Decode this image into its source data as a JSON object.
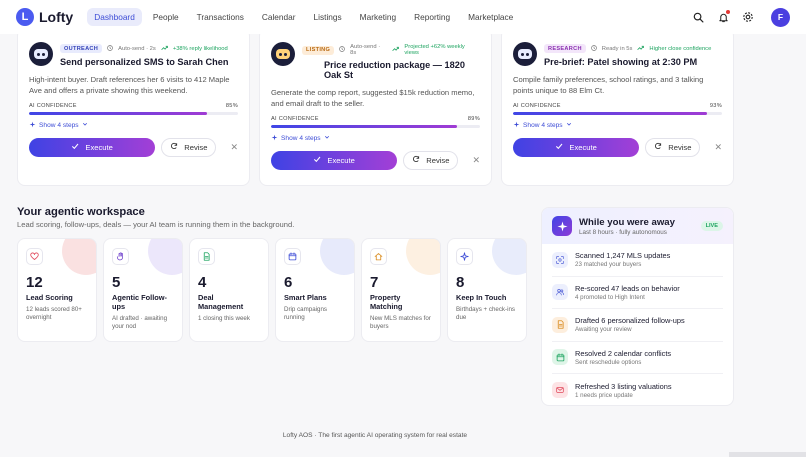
{
  "app": {
    "logo_text": "Lofty",
    "logo_letter": "L"
  },
  "nav": {
    "items": [
      "Dashboard",
      "People",
      "Transactions",
      "Calendar",
      "Listings",
      "Marketing",
      "Reporting",
      "Marketplace"
    ],
    "active": "Dashboard",
    "avatar_letter": "F"
  },
  "cards": [
    {
      "badge": "OUTREACH",
      "send": "Auto-send · 2s",
      "extra": "+38% reply likelihood",
      "title": "Send personalized SMS to Sarah Chen",
      "desc": "High-intent buyer. Draft references her 6 visits to 412 Maple Ave and offers a private showing this weekend.",
      "conf_label": "AI CONFIDENCE",
      "conf_value": "85%",
      "conf": 0.85,
      "steps": "Show 4 steps",
      "execute": "Execute",
      "revise": "Revise"
    },
    {
      "badge": "LISTING",
      "send": "Auto-send · 8s",
      "extra": "Projected +62% weekly views",
      "title": "Price reduction package — 1820 Oak St",
      "desc": "Generate the comp report, suggested $15k reduction memo, and email draft to the seller.",
      "conf_label": "AI CONFIDENCE",
      "conf_value": "89%",
      "conf": 0.89,
      "steps": "Show 4 steps",
      "execute": "Execute",
      "revise": "Revise"
    },
    {
      "badge": "RESEARCH",
      "send": "Ready in 5s",
      "extra": "Higher close confidence",
      "title": "Pre-brief: Patel showing at 2:30 PM",
      "desc": "Compile family preferences, school ratings, and 3 talking points unique to 88 Elm Ct.",
      "conf_label": "AI CONFIDENCE",
      "conf_value": "93%",
      "conf": 0.93,
      "steps": "Show 4 steps",
      "execute": "Execute",
      "revise": "Revise"
    }
  ],
  "workspace": {
    "title": "Your agentic workspace",
    "subtitle": "Lead scoring, follow-ups, deals — your AI team is running them in the background.",
    "tiles": [
      {
        "num": "12",
        "label": "Lead Scoring",
        "desc": "12 leads scored 80+ overnight",
        "icon": "heart-icon",
        "color": "#f6c9c9",
        "tint": "#e0475a"
      },
      {
        "num": "5",
        "label": "Agentic Follow-ups",
        "desc": "AI drafted · awaiting your nod",
        "icon": "hand-icon",
        "color": "#dcd3f7",
        "tint": "#7a4fd0"
      },
      {
        "num": "4",
        "label": "Deal Management",
        "desc": "1 closing this week",
        "icon": "document-icon",
        "color": "#ffffff",
        "tint": "#1ea460"
      },
      {
        "num": "6",
        "label": "Smart Plans",
        "desc": "Drip campaigns running",
        "icon": "calendar-icon",
        "color": "#d3d9f7",
        "tint": "#3d4cd6"
      },
      {
        "num": "7",
        "label": "Property Matching",
        "desc": "New MLS matches for buyers",
        "icon": "home-icon",
        "color": "#fbe3c8",
        "tint": "#d98b1f"
      },
      {
        "num": "8",
        "label": "Keep In Touch",
        "desc": "Birthdays + check-ins due",
        "icon": "sparkle-icon",
        "color": "#d6dcf7",
        "tint": "#3d4cd6"
      }
    ]
  },
  "away": {
    "title": "While you were away",
    "subtitle": "Last 8 hours · fully autonomous",
    "live": "LIVE",
    "items": [
      {
        "title": "Scanned 1,247 MLS updates",
        "sub": "23 matched your buyers",
        "icon": "scan-icon",
        "bg": "#eceffd",
        "tint": "#5463d8"
      },
      {
        "title": "Re-scored 47 leads on behavior",
        "sub": "4 promoted to High Intent",
        "icon": "users-icon",
        "bg": "#eceffd",
        "tint": "#5463d8"
      },
      {
        "title": "Drafted 6 personalized follow-ups",
        "sub": "Awaiting your review",
        "icon": "file-icon",
        "bg": "#fdeedd",
        "tint": "#d98b1f"
      },
      {
        "title": "Resolved 2 calendar conflicts",
        "sub": "Sent reschedule options",
        "icon": "calendar-icon",
        "bg": "#dff5e8",
        "tint": "#1ea460"
      },
      {
        "title": "Refreshed 3 listing valuations",
        "sub": "1 needs price update",
        "icon": "mail-icon",
        "bg": "#fde3e5",
        "tint": "#e0475a"
      }
    ]
  },
  "footer": "Lofty AOS · The first agentic AI operating system for real estate"
}
